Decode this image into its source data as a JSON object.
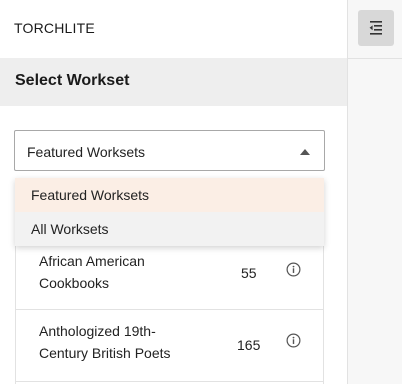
{
  "app": {
    "brand": "TORCHLITE"
  },
  "workset_panel": {
    "title": "Select Workset",
    "select": {
      "value": "Featured Worksets"
    },
    "menu": {
      "options": [
        "Featured Worksets",
        "All Worksets"
      ]
    },
    "rows": [
      {
        "title": "African American Cookbooks",
        "count": "55"
      },
      {
        "title": "Anthologized 19th-Century British Poets",
        "count": "165"
      }
    ]
  },
  "icons": {
    "info": "info-icon",
    "caret": "caret-up-icon",
    "menu_toggle": "menu-collapse-icon"
  },
  "colors": {
    "selected_option_bg": "#fbeee5",
    "header_bg": "#eeeeee",
    "toggle_bg": "#d8d8d8"
  }
}
